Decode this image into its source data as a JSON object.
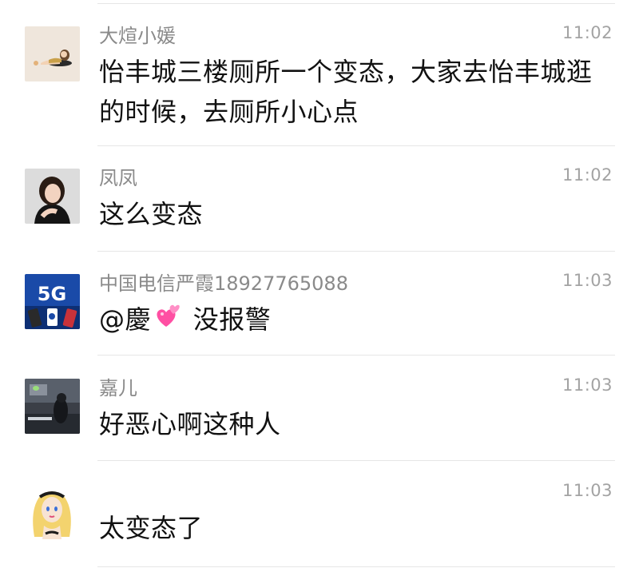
{
  "messages": [
    {
      "sender": "大煊小媛",
      "time": "11:02",
      "text": "怡丰城三楼厕所一个变态，大家去怡丰城逛的时候，去厕所小心点",
      "avatar_icon": "illustration-reclining-woman-avatar"
    },
    {
      "sender": "凤凤",
      "time": "11:02",
      "text": "这么变态",
      "avatar_icon": "photo-woman-black-top-avatar"
    },
    {
      "sender": "中国电信严霞18927765088",
      "time": "11:03",
      "text_prefix": "@慶",
      "emoji": "two-hearts-emoji",
      "text_suffix": " 没报警",
      "avatar_icon": "5g-telecom-avatar",
      "avatar_badge": "5G"
    },
    {
      "sender": "嘉儿",
      "time": "11:03",
      "text": "好恶心啊这种人",
      "avatar_icon": "dark-room-photo-avatar"
    },
    {
      "sender": "",
      "time": "11:03",
      "text": "太变态了",
      "avatar_icon": "blonde-cartoon-girl-avatar"
    }
  ],
  "colors": {
    "sender_name": "#8a8a8a",
    "time": "#a3a3a3",
    "message_text": "#111111",
    "divider": "#e6e6e6",
    "telecom_blue": "#1a4aa8",
    "heart_pink": "#ff4fa3"
  }
}
